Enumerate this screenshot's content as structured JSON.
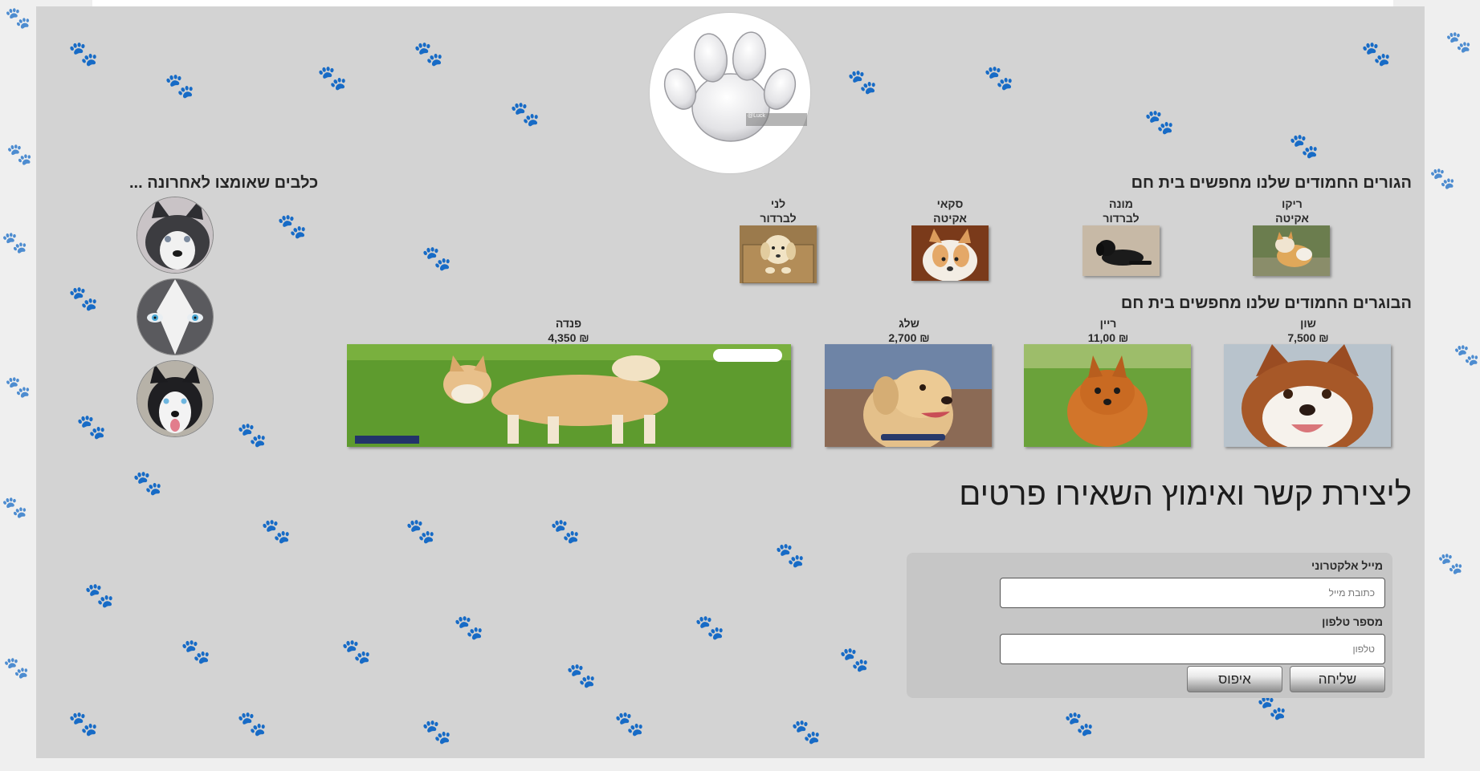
{
  "logo": {
    "icon": "paw-icon",
    "watermark": "@Luck"
  },
  "puppies": {
    "heading": "הגורים החמודים שלנו מחפשים בית חם",
    "items": [
      {
        "name": "ריקו",
        "breed": "אקיטה"
      },
      {
        "name": "מונה",
        "breed": "לברדור"
      },
      {
        "name": "סקאי",
        "breed": "אקיטה"
      },
      {
        "name": "לני",
        "breed": "לברדור"
      }
    ]
  },
  "adults": {
    "heading": "הבוגרים החמודים שלנו מחפשים בית חם",
    "items": [
      {
        "name": "שון",
        "price": "7,500 ₪"
      },
      {
        "name": "ריין",
        "price": "11,00 ₪"
      },
      {
        "name": "שלג",
        "price": "2,700 ₪"
      },
      {
        "name": "פנדה",
        "price": "4,350 ₪"
      }
    ]
  },
  "adopted": {
    "heading": "כלבים שאומצו לאחרונה ..."
  },
  "contact": {
    "title": "ליצירת קשר ואימוץ השאירו פרטים",
    "email_label": "מייל אלקטרוני",
    "email_placeholder": "כתובת מייל",
    "phone_label": "מספר טלפון",
    "phone_placeholder": "טלפון",
    "submit_label": "שליחה",
    "reset_label": "איפוס"
  },
  "colors": {
    "background": "#efefef",
    "content_panel": "#d3d3d3",
    "form_panel": "#c6c6c6"
  }
}
